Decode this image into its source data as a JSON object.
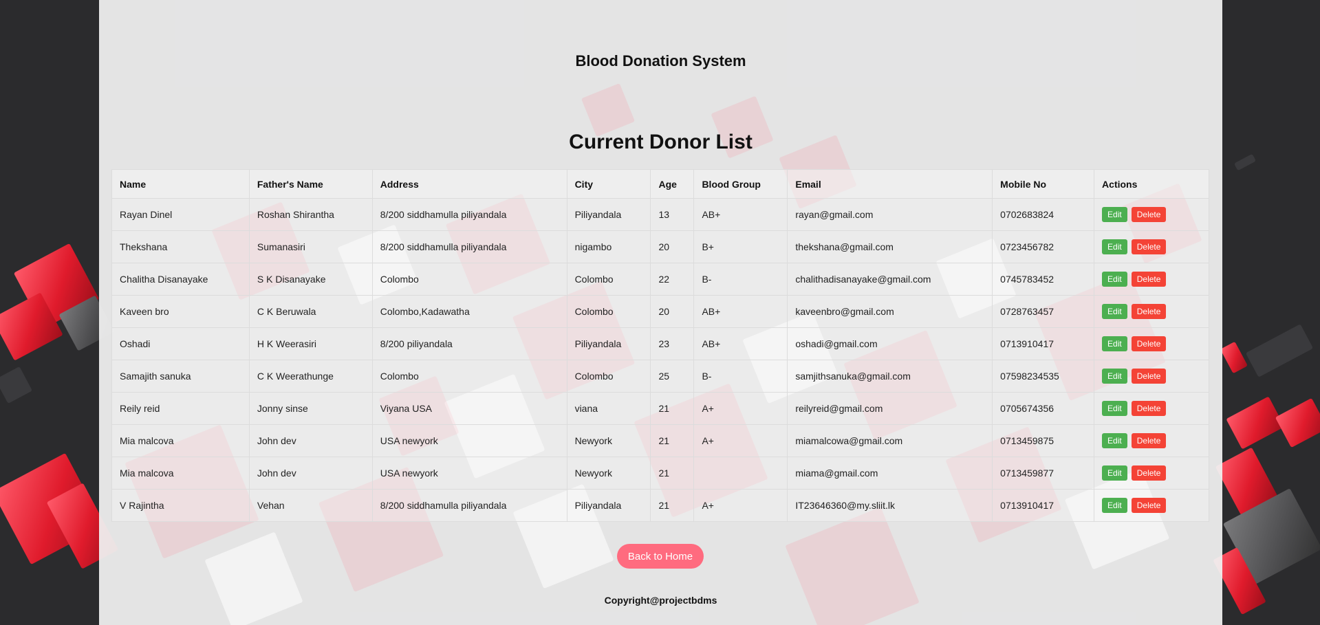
{
  "header": {
    "site_title": "Blood Donation System"
  },
  "main": {
    "heading": "Current Donor List",
    "table": {
      "columns": [
        "Name",
        "Father's Name",
        "Address",
        "City",
        "Age",
        "Blood Group",
        "Email",
        "Mobile No",
        "Actions"
      ],
      "rows": [
        [
          "Rayan Dinel",
          "Roshan Shirantha",
          "8/200 siddhamulla piliyandala",
          "Piliyandala",
          "13",
          "AB+",
          "rayan@gmail.com",
          "0702683824"
        ],
        [
          "Thekshana",
          "Sumanasiri",
          "8/200 siddhamulla piliyandala",
          "nigambo",
          "20",
          "B+",
          "thekshana@gmail.com",
          "0723456782"
        ],
        [
          "Chalitha Disanayake",
          "S K Disanayake",
          "Colombo",
          "Colombo",
          "22",
          "B-",
          "chalithadisanayake@gmail.com",
          "0745783452"
        ],
        [
          "Kaveen bro",
          "C K Beruwala",
          "Colombo,Kadawatha",
          "Colombo",
          "20",
          "AB+",
          "kaveenbro@gmail.com",
          "0728763457"
        ],
        [
          "Oshadi",
          "H K Weerasiri",
          "8/200 piliyandala",
          "Piliyandala",
          "23",
          "AB+",
          "oshadi@gmail.com",
          "0713910417"
        ],
        [
          "Samajith sanuka",
          "C K Weerathunge",
          "Colombo",
          "Colombo",
          "25",
          "B-",
          "samjithsanuka@gmail.com",
          "07598234535"
        ],
        [
          "Reily reid",
          "Jonny sinse",
          "Viyana USA",
          "viana",
          "21",
          "A+",
          "reilyreid@gmail.com",
          "0705674356"
        ],
        [
          "Mia malcova",
          "John dev",
          "USA newyork",
          "Newyork",
          "21",
          "A+",
          "miamalcowa@gmail.com",
          "0713459875"
        ],
        [
          "Mia malcova",
          "John dev",
          "USA newyork",
          "Newyork",
          "21",
          "",
          "miama@gmail.com",
          "0713459877"
        ],
        [
          "V Rajintha",
          "Vehan",
          "8/200 siddhamulla piliyandala",
          "Piliyandala",
          "21",
          "A+",
          "IT23646360@my.sliit.lk",
          "0713910417"
        ]
      ],
      "edit_label": "Edit",
      "delete_label": "Delete"
    },
    "back_home_label": "Back to Home"
  },
  "footer": {
    "copyright": "Copyright@projectbdms"
  },
  "colors": {
    "edit_button": "#4caf50",
    "delete_button": "#f44336",
    "home_button": "#ff6b7f",
    "page_background": "#2b2b2d"
  }
}
